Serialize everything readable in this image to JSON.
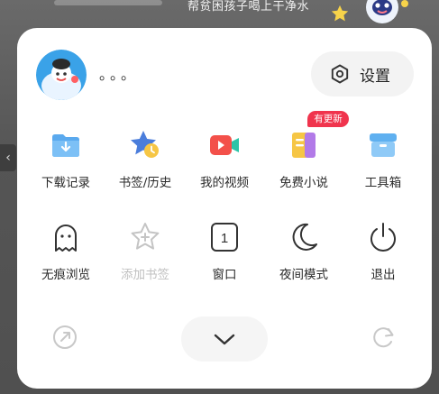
{
  "banner": {
    "text": "帮贫困孩子喝上干净水"
  },
  "profile": {
    "username": "。。。"
  },
  "settings": {
    "label": "设置",
    "icon": "hexagon-settings-icon"
  },
  "grid": [
    {
      "label": "下载记录",
      "icon": "download-folder-icon",
      "disabled": false
    },
    {
      "label": "书签/历史",
      "icon": "star-clock-icon",
      "disabled": false
    },
    {
      "label": "我的视频",
      "icon": "video-camera-icon",
      "disabled": false
    },
    {
      "label": "免费小说",
      "icon": "novel-book-icon",
      "disabled": false,
      "badge": "有更新"
    },
    {
      "label": "工具箱",
      "icon": "toolbox-icon",
      "disabled": false
    },
    {
      "label": "无痕浏览",
      "icon": "ghost-icon",
      "disabled": false
    },
    {
      "label": "添加书签",
      "icon": "add-star-icon",
      "disabled": true
    },
    {
      "label": "窗口",
      "icon": "window-count-icon",
      "disabled": false,
      "count": "1"
    },
    {
      "label": "夜间模式",
      "icon": "moon-icon",
      "disabled": false
    },
    {
      "label": "退出",
      "icon": "power-icon",
      "disabled": false
    }
  ],
  "colors": {
    "accent_red": "#f0344d",
    "download_blue": "#5aa9ee",
    "bookmark_star": "#4a7ddb",
    "video_red": "#f3504a",
    "novel_yellow": "#f6c645",
    "toolbox_blue": "#5fb0f0"
  }
}
